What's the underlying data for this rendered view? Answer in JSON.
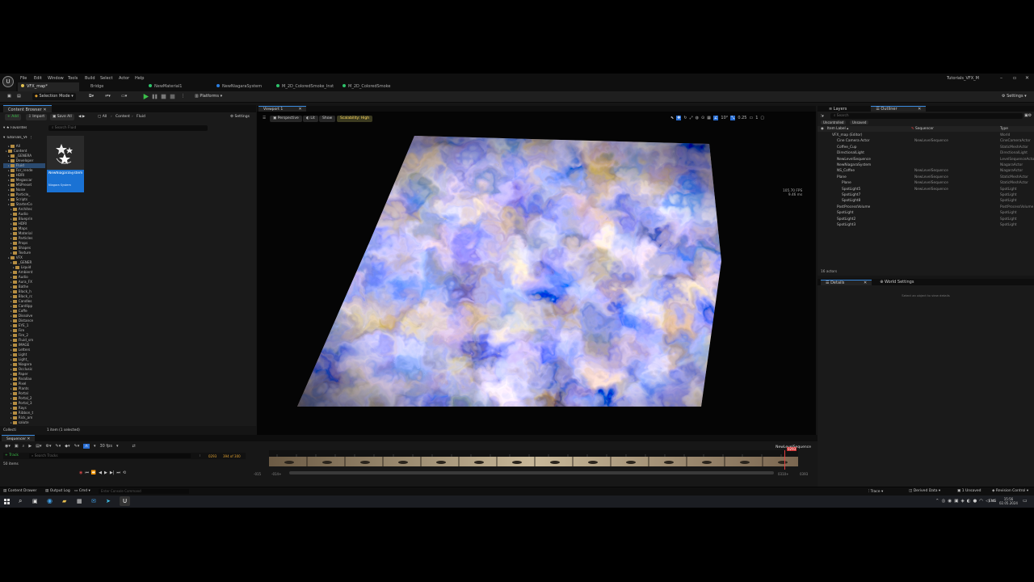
{
  "menubar": {
    "items": [
      "File",
      "Edit",
      "Window",
      "Tools",
      "Build",
      "Select",
      "Actor",
      "Help"
    ],
    "project": "Tutorials_VFX_M"
  },
  "tabs": [
    {
      "label": "VFX_map*",
      "color": "#e0c050"
    },
    {
      "label": "Bridge",
      "color": ""
    },
    {
      "label": "NewMaterial1",
      "color": "#2ec26a"
    },
    {
      "label": "NewNiagaraSystem",
      "color": "#2a7de1"
    },
    {
      "label": "M_2D_ColoredSmoke_Inst",
      "color": "#2ec26a"
    },
    {
      "label": "M_2D_ColoredSmoke",
      "color": "#2ec26a"
    }
  ],
  "toolbar": {
    "selection_mode": "Selection Mode",
    "platforms": "Platforms",
    "settings": "Settings"
  },
  "content_browser": {
    "title": "Content Browser",
    "add": "+ Add",
    "import": "Import",
    "save_all": "Save All",
    "crumbs": [
      "All",
      "Content",
      "Fluid"
    ],
    "settings": "Settings",
    "favorites": "Favorites",
    "root": "Tutorials_VF",
    "search_placeholder": "Search Fluid",
    "tree": [
      "All",
      "Content",
      "_GENERA",
      "Developer",
      "Fluid",
      "For_rende",
      "HDRI",
      "Megascar",
      "MSPreset",
      "Noise",
      "Particle_",
      "Scripts",
      "StarterCo",
      "Architec",
      "Audio",
      "Blueprin",
      "HDRI",
      "Maps",
      "Material",
      "Particles",
      "Props",
      "Shapes",
      "Texture",
      "VFX",
      "_GENER",
      "Liquid",
      "Ambient",
      "Audio",
      "Aura_FX",
      "Bathe",
      "Black_h",
      "Black_rc",
      "Candles",
      "Cardlipp",
      "Coffe",
      "Dissolve",
      "Distance",
      "EYE_1",
      "Fire",
      "Fire_2",
      "Fluid_sm",
      "IMAGE",
      "Letters",
      "Light",
      "Light_",
      "Niagara",
      "Occlusic",
      "Paper",
      "Parallax",
      "Pixel",
      "Plants",
      "Portal",
      "Portal_2",
      "Portal_3",
      "Rays",
      "Ribbon_t",
      "Rick_am",
      "salute"
    ],
    "asset": {
      "name": "NewNiagaraSystem",
      "type": "Niagara System"
    },
    "collections": "Collecti",
    "status": "1 item (1 selected)"
  },
  "viewport": {
    "tab": "Viewport 1",
    "perspective": "Perspective",
    "lit": "Lit",
    "show": "Show",
    "scalability": "Scalability: High",
    "fps": "105.70 FPS",
    "ms": "9.46 ms",
    "sequence_label": "NewLevelSequence",
    "frame_right": "0293",
    "time_left": "0000",
    "time_left2": "-0141",
    "time_current": "0293",
    "time_right": "0310+",
    "time_right2": "0393"
  },
  "sequencer": {
    "title": "Sequencer",
    "fps": "30 fps",
    "sequence_name": "NewLevelSequence",
    "track": "+ Track",
    "search_placeholder": "Search Tracks",
    "frame": "0293",
    "of": "394 of 300",
    "items": "50 items",
    "playhead": "0293",
    "ruler_left": "-015",
    "ruler_left2": "-014+",
    "ruler_right": "0310+",
    "ruler_right2": "0393"
  },
  "outliner": {
    "tab_layers": "Layers",
    "tab_outliner": "Outliner",
    "search_placeholder": "Search",
    "filter_unsaved": "Unsaved",
    "filter_uncontrolled": "Uncontrolled",
    "col_label": "Item Label",
    "col_sequence": "Sequencer",
    "col_type": "Type",
    "rows": [
      {
        "label": "VFX_map (Editor)",
        "seq": "",
        "type": "World"
      },
      {
        "label": "Cine Camera Actor",
        "seq": "NewLevelSequence",
        "type": "CineCameraActor"
      },
      {
        "label": "Coffee_Cup",
        "seq": "",
        "type": "StaticMeshActor"
      },
      {
        "label": "DirectionalLight",
        "seq": "",
        "type": "DirectionalLight"
      },
      {
        "label": "NewLevelSequence",
        "seq": "",
        "type": "LevelSequenceActor"
      },
      {
        "label": "NewNiagaraSystem",
        "seq": "",
        "type": "NiagaraActor"
      },
      {
        "label": "NS_Coffee",
        "seq": "NewLevelSequence",
        "type": "NiagaraActor"
      },
      {
        "label": "Plane",
        "seq": "NewLevelSequence",
        "type": "StaticMeshActor"
      },
      {
        "label": "Plane",
        "seq": "NewLevelSequence",
        "type": "StaticMeshActor"
      },
      {
        "label": "SpotLight5",
        "seq": "NewLevelSequence",
        "type": "SpotLight"
      },
      {
        "label": "SpotLight7",
        "seq": "",
        "type": "SpotLight"
      },
      {
        "label": "SpotLight8",
        "seq": "",
        "type": "SpotLight"
      },
      {
        "label": "PostProcessVolume",
        "seq": "",
        "type": "PostProcessVolume"
      },
      {
        "label": "SpotLight",
        "seq": "",
        "type": "SpotLight"
      },
      {
        "label": "SpotLight2",
        "seq": "",
        "type": "SpotLight"
      },
      {
        "label": "SpotLight3",
        "seq": "",
        "type": "SpotLight"
      }
    ],
    "count": "16 actors"
  },
  "details": {
    "tab_details": "Details",
    "tab_world": "World Settings",
    "empty": "Select an object to view details"
  },
  "statusbar": {
    "content_drawer": "Content Drawer",
    "output_log": "Output Log",
    "cmd": "Cmd",
    "console_placeholder": "Enter Console Command",
    "trace": "Trace",
    "derived": "Derived Data",
    "unsaved": "1 Unsaved",
    "revision": "Revision Control"
  },
  "taskbar": {
    "lang": "ENG",
    "time": "15:56",
    "date": "02.05.2024"
  }
}
